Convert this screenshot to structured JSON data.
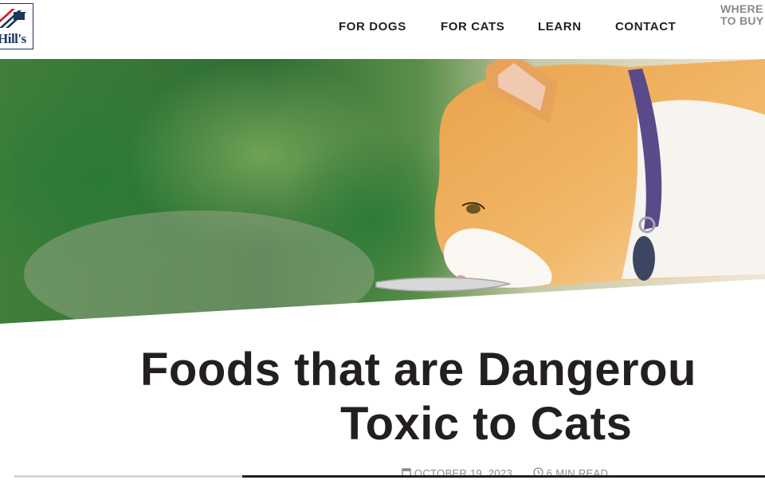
{
  "brand": {
    "logo_text": "Hill's",
    "colors": {
      "navy": "#1b365d",
      "red": "#d71920",
      "text": "#231f20",
      "muted": "#8a8a8a"
    }
  },
  "nav": {
    "items": [
      {
        "label": "FOR DOGS"
      },
      {
        "label": "FOR CATS"
      },
      {
        "label": "LEARN"
      },
      {
        "label": "CONTACT"
      }
    ],
    "where_to_buy": {
      "line1": "WHERE",
      "line2": "TO BUY"
    }
  },
  "hero": {
    "image": "cat-eating-from-bowl"
  },
  "article": {
    "title_line1": "Foods that are Dangerou",
    "title_line2": "Toxic to Cats",
    "date": "OCTOBER 19, 2023",
    "read_time": "6 MIN READ",
    "icons": {
      "date": "calendar-icon",
      "read_time": "clock-icon"
    }
  }
}
